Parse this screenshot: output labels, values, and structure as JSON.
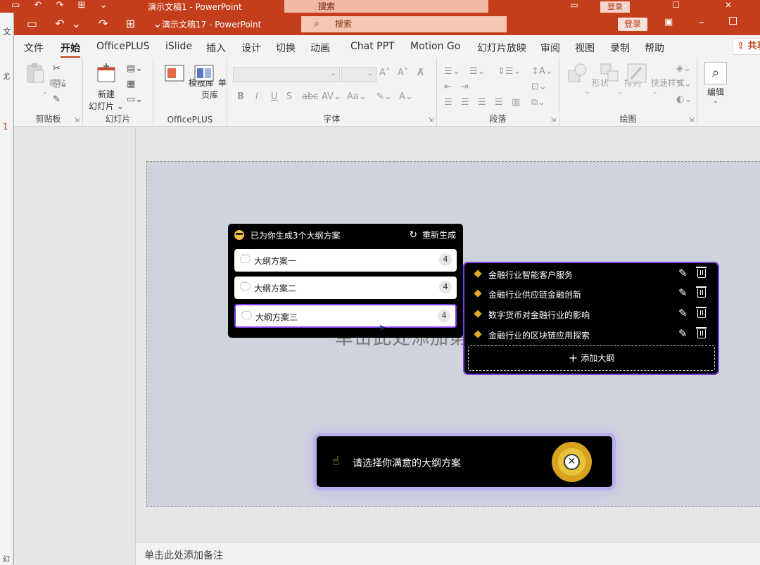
{
  "background_window": {
    "title": "演示文稿1  -  PowerPoint",
    "search_placeholder": "搜索",
    "login_label": "登录",
    "left_labels": [
      "文",
      "尤",
      "1",
      "幻"
    ]
  },
  "window": {
    "title": "演示文稿17  -  PowerPoint",
    "search_placeholder": "搜索",
    "login_label": "登录",
    "share_label": "共享"
  },
  "tabs": [
    {
      "label": "文件"
    },
    {
      "label": "开始",
      "active": true
    },
    {
      "label": "OfficePLUS"
    },
    {
      "label": "iSlide"
    },
    {
      "label": "插入"
    },
    {
      "label": "设计"
    },
    {
      "label": "切换"
    },
    {
      "label": "动画"
    },
    {
      "label": "Chat PPT"
    },
    {
      "label": "Motion Go"
    },
    {
      "label": "幻灯片放映"
    },
    {
      "label": "审阅"
    },
    {
      "label": "视图"
    },
    {
      "label": "录制"
    },
    {
      "label": "帮助"
    }
  ],
  "ribbon": {
    "groups": {
      "clipboard": "剪贴板",
      "slides": "幻灯片",
      "officeplus": "OfficePLUS",
      "font": "字体",
      "paragraph": "段落",
      "drawing": "绘图"
    },
    "paste_label": "粘贴",
    "new_slide_label": "新建",
    "new_slide_label2": "幻灯片",
    "template_label": "模板库",
    "single_page_label": "单页库",
    "shapes_label": "形状",
    "arrange_label": "排列",
    "quick_styles_label": "快速样式",
    "edit_label": "编辑"
  },
  "slide": {
    "placeholder_text": "单击此处添加第",
    "notes_placeholder": "单击此处添加备注"
  },
  "options_panel": {
    "header": "已为你生成3个大纲方案",
    "regenerate_label": "重新生成",
    "options": [
      {
        "label": "大纲方案一",
        "count": "4"
      },
      {
        "label": "大纲方案二",
        "count": "4"
      },
      {
        "label": "大纲方案三",
        "count": "4",
        "selected": true
      }
    ]
  },
  "outline_panel": {
    "items": [
      "金融行业智能客户服务",
      "金融行业供应链金融创新",
      "数字货币对金融行业的影响",
      "金融行业的区块链应用探索"
    ],
    "add_label": "添加大纲"
  },
  "prompt": {
    "text": "请选择你满意的大纲方案"
  },
  "colors": {
    "brand": "#c43e1c",
    "accent_purple": "#7b3fe4",
    "diamond": "#e3a72f"
  }
}
